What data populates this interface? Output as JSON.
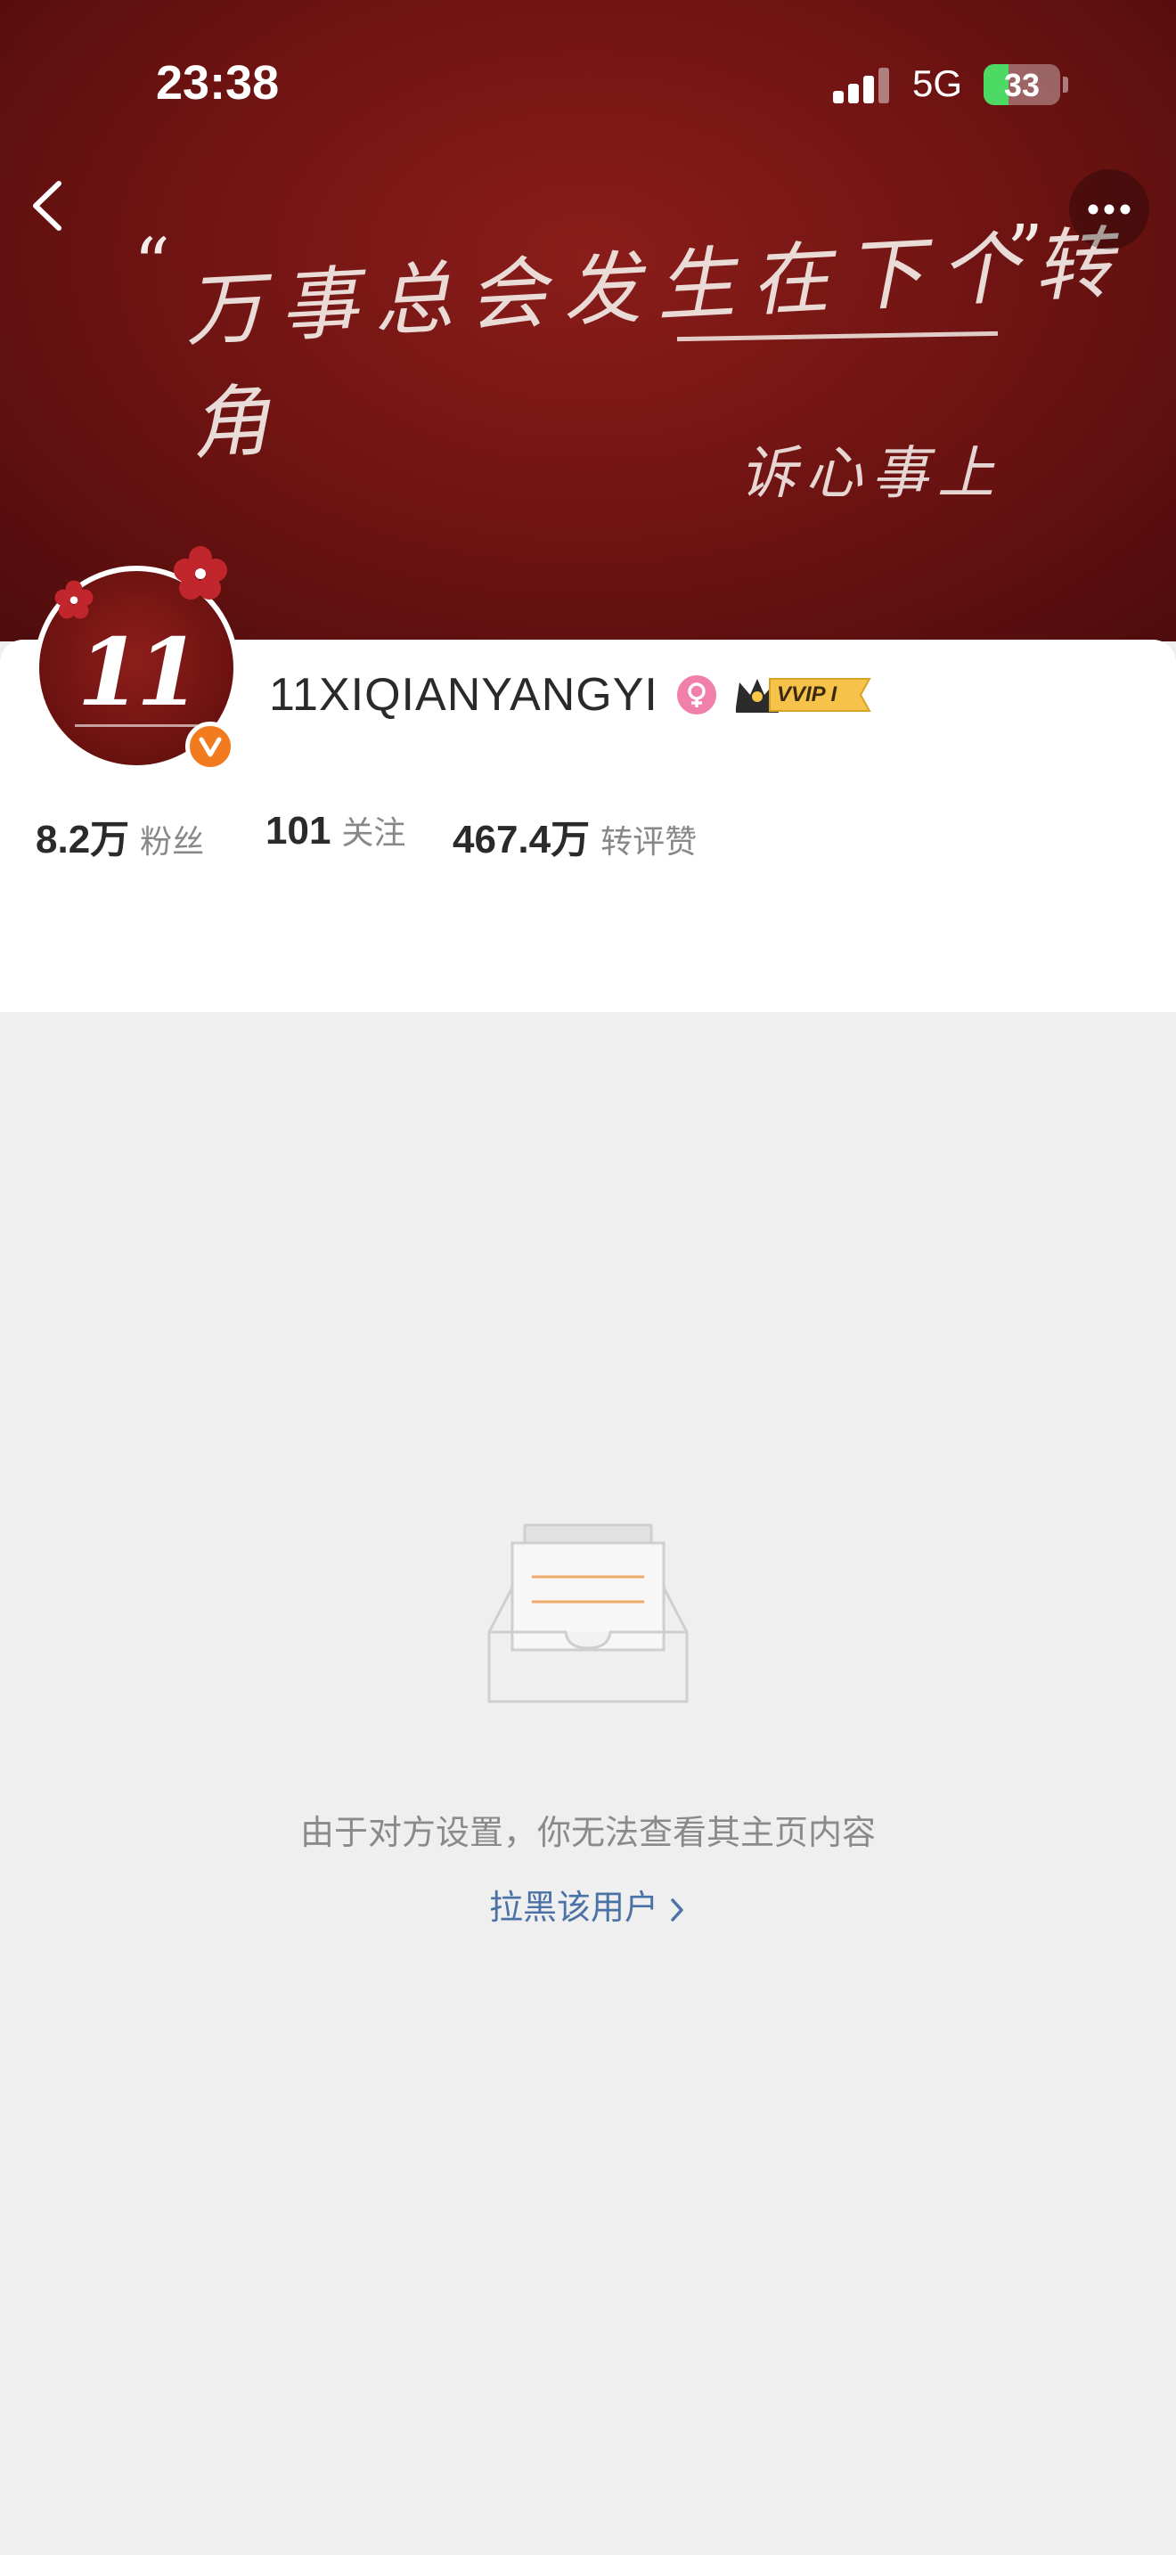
{
  "status_bar": {
    "time": "23:38",
    "network": "5G",
    "battery": "33",
    "battery_level": 0.33
  },
  "cover": {
    "handwriting_line1": "万事总会发生在下个转角",
    "handwriting_line2": "诉心事上"
  },
  "icons": {
    "back": "chevron-left-icon",
    "more": "ellipsis-icon",
    "verified": "verified-v-icon",
    "gender": "female-icon",
    "vip": "vvip-crown-badge"
  },
  "profile": {
    "avatar_text": "11",
    "username": "11XIQIANYANGYI",
    "vip_label": "VVIP I",
    "stats": [
      {
        "value": "8.2万",
        "label": "粉丝"
      },
      {
        "value": "101",
        "label": "关注"
      },
      {
        "value": "467.4万",
        "label": "转评赞"
      }
    ]
  },
  "empty_state": {
    "message": "由于对方设置，你无法查看其主页内容",
    "link": "拉黑该用户"
  },
  "colors": {
    "cover_red": "#6c1312",
    "link_blue": "#4b72a6",
    "verified_orange": "#f27a1f",
    "page_bg": "#efefef"
  }
}
